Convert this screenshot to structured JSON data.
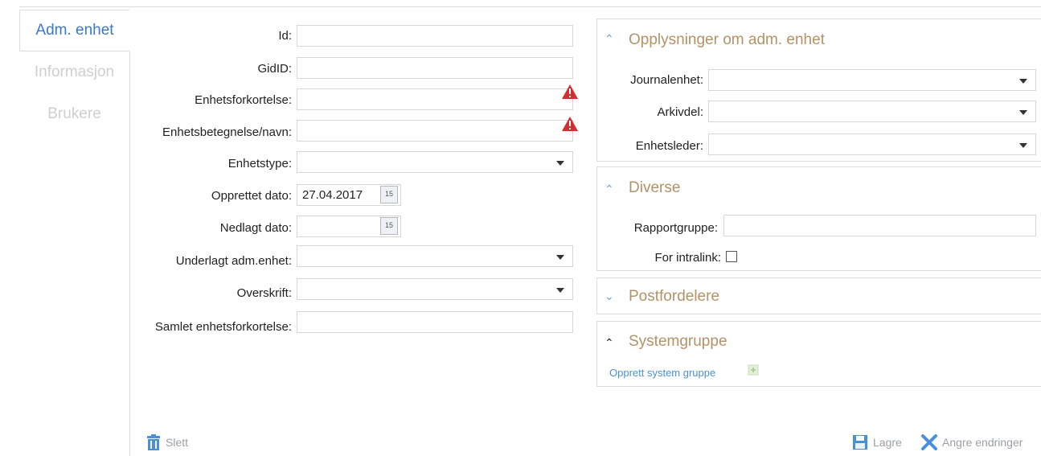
{
  "tabs": [
    {
      "label": "Adm. enhet",
      "active": true
    },
    {
      "label": "Informasjon",
      "active": false
    },
    {
      "label": "Brukere",
      "active": false
    }
  ],
  "form": {
    "id_label": "Id:",
    "gidid_label": "GidID:",
    "enhetsforkortelse_label": "Enhetsforkortelse:",
    "enhetsbetegnelse_label": "Enhetsbetegnelse/navn:",
    "enhetstype_label": "Enhetstype:",
    "opprettet_label": "Opprettet dato:",
    "opprettet_value": "27.04.2017",
    "nedlagt_label": "Nedlagt dato:",
    "underlagt_label": "Underlagt adm.enhet:",
    "overskrift_label": "Overskrift:",
    "samlet_label": "Samlet enhetsforkortelse:",
    "calendar_day": "15"
  },
  "panels": {
    "opplysninger": {
      "title": "Opplysninger om adm. enhet",
      "journalenhet_label": "Journalenhet:",
      "arkivdel_label": "Arkivdel:",
      "enhetsleder_label": "Enhetsleder:"
    },
    "diverse": {
      "title": "Diverse",
      "rapportgruppe_label": "Rapportgruppe:",
      "intralink_label": "For intralink:"
    },
    "postfordelere": {
      "title": "Postfordelere"
    },
    "systemgruppe": {
      "title": "Systemgruppe",
      "create_link": "Opprett system gruppe"
    }
  },
  "footer": {
    "delete_label": "Slett",
    "save_label": "Lagre",
    "undo_label": "Angre endringer"
  },
  "colors": {
    "accent": "#3b78c8",
    "panel_title": "#b49267",
    "warning": "#d32f2f"
  }
}
